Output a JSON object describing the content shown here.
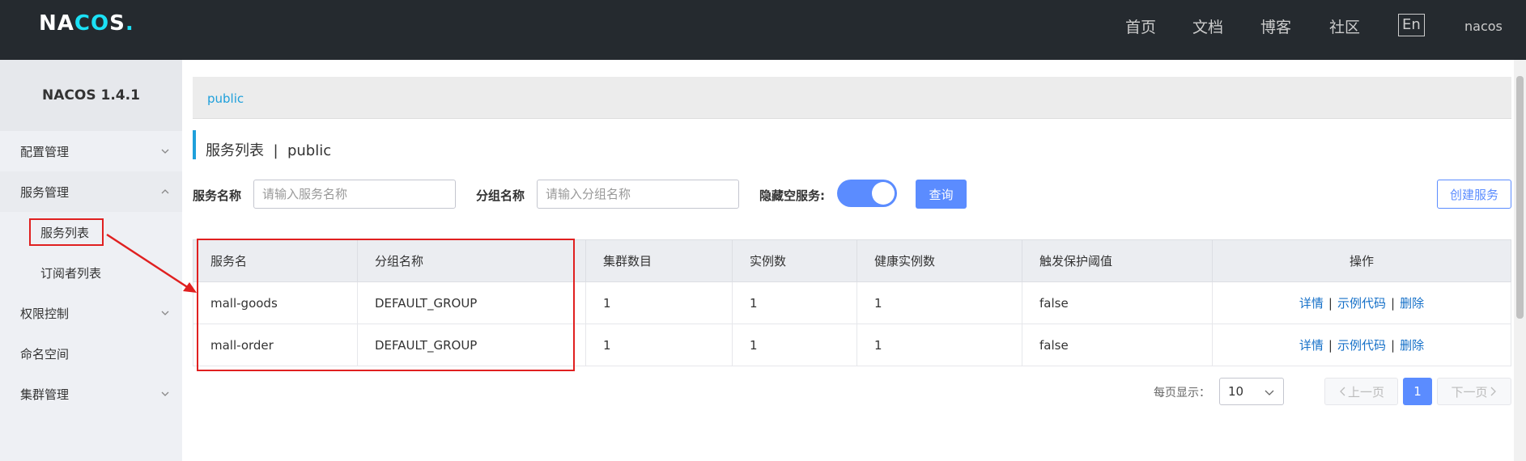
{
  "header": {
    "logo_text_1": "NA",
    "logo_text_2": "C",
    "logo_text_3": "O",
    "logo_text_4": "S",
    "logo_dot": ".",
    "nav": [
      "首页",
      "文档",
      "博客",
      "社区"
    ],
    "lang": "En",
    "user": "nacos"
  },
  "sidebar": {
    "title": "NACOS 1.4.1",
    "items": [
      {
        "label": "配置管理"
      },
      {
        "label": "服务管理"
      },
      {
        "label": "服务列表"
      },
      {
        "label": "订阅者列表"
      },
      {
        "label": "权限控制"
      },
      {
        "label": "命名空间"
      },
      {
        "label": "集群管理"
      }
    ]
  },
  "breadcrumb": "public",
  "page_title": "服务列表  |  public",
  "filters": {
    "service_name_label": "服务名称",
    "service_name_placeholder": "请输入服务名称",
    "group_name_label": "分组名称",
    "group_name_placeholder": "请输入分组名称",
    "hide_empty_label": "隐藏空服务:",
    "hide_empty_on": true,
    "query_button": "查询",
    "create_button": "创建服务"
  },
  "table": {
    "columns": [
      "服务名",
      "分组名称",
      "集群数目",
      "实例数",
      "健康实例数",
      "触发保护阈值",
      "操作"
    ],
    "rows": [
      {
        "name": "mall-goods",
        "group": "DEFAULT_GROUP",
        "clusters": "1",
        "instances": "1",
        "healthy": "1",
        "threshold": "false"
      },
      {
        "name": "mall-order",
        "group": "DEFAULT_GROUP",
        "clusters": "1",
        "instances": "1",
        "healthy": "1",
        "threshold": "false"
      }
    ],
    "actions": {
      "detail": "详情",
      "sample": "示例代码",
      "delete": "删除",
      "separator": "|"
    }
  },
  "pagination": {
    "page_size_label": "每页显示：",
    "page_size": "10",
    "prev": "上一页",
    "current": "1",
    "next": "下一页"
  },
  "colors": {
    "topbar": "#252a2f",
    "accent": "#5b8cff",
    "link": "#1570c8",
    "annotation": "#e02020"
  }
}
